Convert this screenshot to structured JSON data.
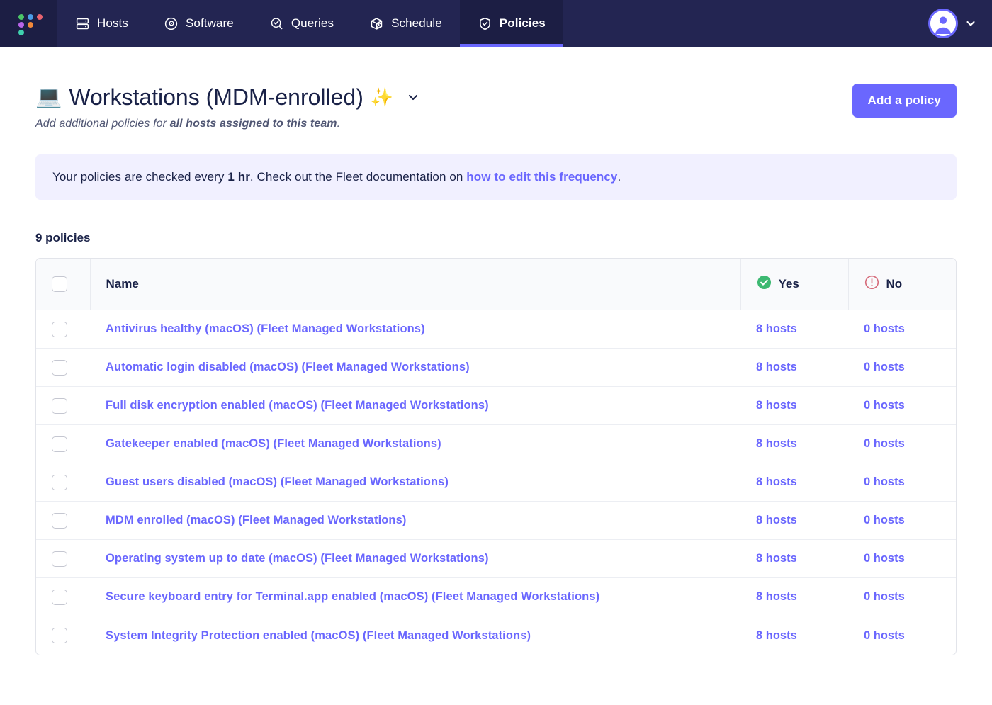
{
  "navbar": {
    "logo_name": "fleet-logo",
    "items": [
      {
        "label": "Hosts",
        "icon": "server-icon",
        "active": false
      },
      {
        "label": "Software",
        "icon": "disc-icon",
        "active": false
      },
      {
        "label": "Queries",
        "icon": "search-check-icon",
        "active": false
      },
      {
        "label": "Schedule",
        "icon": "box-clock-icon",
        "active": false
      },
      {
        "label": "Policies",
        "icon": "shield-check-icon",
        "active": true
      }
    ],
    "avatar_name": "user-avatar",
    "caret_name": "chevron-down-icon"
  },
  "header": {
    "emoji": "💻",
    "title": "Workstations (MDM-enrolled)",
    "sparkle": "✨",
    "subtitle_prefix": "Add additional policies for ",
    "subtitle_bold": "all hosts assigned to this team",
    "subtitle_suffix": ".",
    "add_policy_label": "Add a policy"
  },
  "banner": {
    "text_before": "Your policies are checked every ",
    "frequency": "1 hr",
    "text_middle": ". Check out the Fleet documentation on ",
    "link_text": "how to edit this frequency",
    "text_after": "."
  },
  "table": {
    "count_label": "9 policies",
    "columns": {
      "name": "Name",
      "yes": "Yes",
      "no": "No"
    },
    "rows": [
      {
        "name": "Antivirus healthy (macOS) (Fleet Managed Workstations)",
        "yes": "8 hosts",
        "no": "0 hosts"
      },
      {
        "name": "Automatic login disabled (macOS) (Fleet Managed Workstations)",
        "yes": "8 hosts",
        "no": "0 hosts"
      },
      {
        "name": "Full disk encryption enabled (macOS) (Fleet Managed Workstations)",
        "yes": "8 hosts",
        "no": "0 hosts"
      },
      {
        "name": "Gatekeeper enabled (macOS) (Fleet Managed Workstations)",
        "yes": "8 hosts",
        "no": "0 hosts"
      },
      {
        "name": "Guest users disabled (macOS) (Fleet Managed Workstations)",
        "yes": "8 hosts",
        "no": "0 hosts"
      },
      {
        "name": "MDM enrolled (macOS) (Fleet Managed Workstations)",
        "yes": "8 hosts",
        "no": "0 hosts"
      },
      {
        "name": "Operating system up to date (macOS) (Fleet Managed Workstations)",
        "yes": "8 hosts",
        "no": "0 hosts"
      },
      {
        "name": "Secure keyboard entry for Terminal.app enabled (macOS) (Fleet Managed Workstations)",
        "yes": "8 hosts",
        "no": "0 hosts"
      },
      {
        "name": "System Integrity Protection enabled (macOS) (Fleet Managed Workstations)",
        "yes": "8 hosts",
        "no": "0 hosts"
      }
    ]
  },
  "colors": {
    "nav_bg": "#232552",
    "nav_active_bg": "#1c1e44",
    "accent": "#6a67fe",
    "banner_bg": "#f1f0ff",
    "yes_green": "#3db972",
    "no_red": "#d66c7b",
    "text_dark": "#192147"
  }
}
